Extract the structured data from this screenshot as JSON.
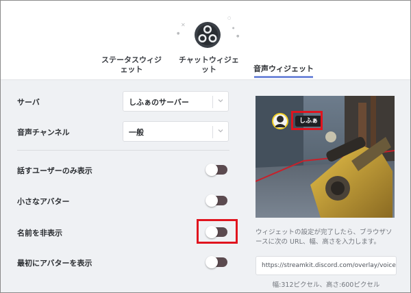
{
  "header": {
    "tabs": [
      {
        "label_line1": "ステータスウィジ",
        "label_line2": "ェット"
      },
      {
        "label_line1": "チャットウィジェ",
        "label_line2": "ット"
      },
      {
        "label": "音声ウィジェット"
      }
    ],
    "active_tab_index": 2
  },
  "settings": {
    "server": {
      "label": "サーバ",
      "value": "しふぁのサーバー"
    },
    "voice_channel": {
      "label": "音声チャンネル",
      "value": "一般"
    },
    "toggles": [
      {
        "label": "話すユーザーのみ表示",
        "on": false
      },
      {
        "label": "小さなアバター",
        "on": false
      },
      {
        "label": "名前を非表示",
        "on": false
      },
      {
        "label": "最初にアバターを表示",
        "on": false
      }
    ]
  },
  "preview": {
    "username": "しふぁ"
  },
  "instructions": "ウィジェットの設定が完了したら、ブラウザソースに次の URL、幅、高さを入力します。",
  "url": "https://streamkit.discord.com/overlay/voice",
  "size_note": "幅:312ピクセル、高さ:600ピクセル",
  "colors": {
    "accent": "#7289da",
    "toggle_track": "#5b4a4f",
    "highlight": "#e0141e"
  }
}
